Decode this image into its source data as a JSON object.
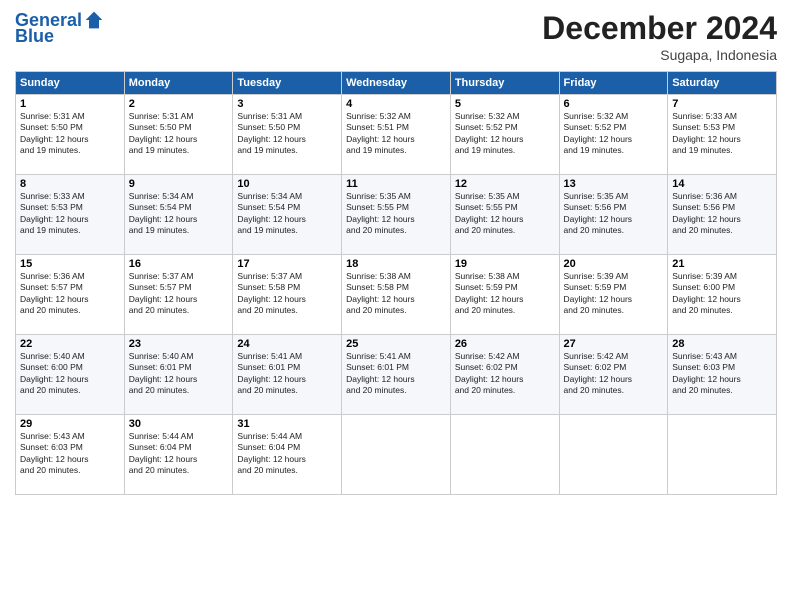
{
  "header": {
    "logo_general": "General",
    "logo_blue": "Blue",
    "month": "December 2024",
    "location": "Sugapa, Indonesia"
  },
  "weekdays": [
    "Sunday",
    "Monday",
    "Tuesday",
    "Wednesday",
    "Thursday",
    "Friday",
    "Saturday"
  ],
  "weeks": [
    [
      {
        "day": "1",
        "sunrise": "5:31 AM",
        "sunset": "5:50 PM",
        "daylight": "12 hours and 19 minutes."
      },
      {
        "day": "2",
        "sunrise": "5:31 AM",
        "sunset": "5:50 PM",
        "daylight": "12 hours and 19 minutes."
      },
      {
        "day": "3",
        "sunrise": "5:31 AM",
        "sunset": "5:50 PM",
        "daylight": "12 hours and 19 minutes."
      },
      {
        "day": "4",
        "sunrise": "5:32 AM",
        "sunset": "5:51 PM",
        "daylight": "12 hours and 19 minutes."
      },
      {
        "day": "5",
        "sunrise": "5:32 AM",
        "sunset": "5:52 PM",
        "daylight": "12 hours and 19 minutes."
      },
      {
        "day": "6",
        "sunrise": "5:32 AM",
        "sunset": "5:52 PM",
        "daylight": "12 hours and 19 minutes."
      },
      {
        "day": "7",
        "sunrise": "5:33 AM",
        "sunset": "5:53 PM",
        "daylight": "12 hours and 19 minutes."
      }
    ],
    [
      {
        "day": "8",
        "sunrise": "5:33 AM",
        "sunset": "5:53 PM",
        "daylight": "12 hours and 19 minutes."
      },
      {
        "day": "9",
        "sunrise": "5:34 AM",
        "sunset": "5:54 PM",
        "daylight": "12 hours and 19 minutes."
      },
      {
        "day": "10",
        "sunrise": "5:34 AM",
        "sunset": "5:54 PM",
        "daylight": "12 hours and 19 minutes."
      },
      {
        "day": "11",
        "sunrise": "5:35 AM",
        "sunset": "5:55 PM",
        "daylight": "12 hours and 20 minutes."
      },
      {
        "day": "12",
        "sunrise": "5:35 AM",
        "sunset": "5:55 PM",
        "daylight": "12 hours and 20 minutes."
      },
      {
        "day": "13",
        "sunrise": "5:35 AM",
        "sunset": "5:56 PM",
        "daylight": "12 hours and 20 minutes."
      },
      {
        "day": "14",
        "sunrise": "5:36 AM",
        "sunset": "5:56 PM",
        "daylight": "12 hours and 20 minutes."
      }
    ],
    [
      {
        "day": "15",
        "sunrise": "5:36 AM",
        "sunset": "5:57 PM",
        "daylight": "12 hours and 20 minutes."
      },
      {
        "day": "16",
        "sunrise": "5:37 AM",
        "sunset": "5:57 PM",
        "daylight": "12 hours and 20 minutes."
      },
      {
        "day": "17",
        "sunrise": "5:37 AM",
        "sunset": "5:58 PM",
        "daylight": "12 hours and 20 minutes."
      },
      {
        "day": "18",
        "sunrise": "5:38 AM",
        "sunset": "5:58 PM",
        "daylight": "12 hours and 20 minutes."
      },
      {
        "day": "19",
        "sunrise": "5:38 AM",
        "sunset": "5:59 PM",
        "daylight": "12 hours and 20 minutes."
      },
      {
        "day": "20",
        "sunrise": "5:39 AM",
        "sunset": "5:59 PM",
        "daylight": "12 hours and 20 minutes."
      },
      {
        "day": "21",
        "sunrise": "5:39 AM",
        "sunset": "6:00 PM",
        "daylight": "12 hours and 20 minutes."
      }
    ],
    [
      {
        "day": "22",
        "sunrise": "5:40 AM",
        "sunset": "6:00 PM",
        "daylight": "12 hours and 20 minutes."
      },
      {
        "day": "23",
        "sunrise": "5:40 AM",
        "sunset": "6:01 PM",
        "daylight": "12 hours and 20 minutes."
      },
      {
        "day": "24",
        "sunrise": "5:41 AM",
        "sunset": "6:01 PM",
        "daylight": "12 hours and 20 minutes."
      },
      {
        "day": "25",
        "sunrise": "5:41 AM",
        "sunset": "6:01 PM",
        "daylight": "12 hours and 20 minutes."
      },
      {
        "day": "26",
        "sunrise": "5:42 AM",
        "sunset": "6:02 PM",
        "daylight": "12 hours and 20 minutes."
      },
      {
        "day": "27",
        "sunrise": "5:42 AM",
        "sunset": "6:02 PM",
        "daylight": "12 hours and 20 minutes."
      },
      {
        "day": "28",
        "sunrise": "5:43 AM",
        "sunset": "6:03 PM",
        "daylight": "12 hours and 20 minutes."
      }
    ],
    [
      {
        "day": "29",
        "sunrise": "5:43 AM",
        "sunset": "6:03 PM",
        "daylight": "12 hours and 20 minutes."
      },
      {
        "day": "30",
        "sunrise": "5:44 AM",
        "sunset": "6:04 PM",
        "daylight": "12 hours and 20 minutes."
      },
      {
        "day": "31",
        "sunrise": "5:44 AM",
        "sunset": "6:04 PM",
        "daylight": "12 hours and 20 minutes."
      },
      null,
      null,
      null,
      null
    ]
  ],
  "labels": {
    "sunrise_prefix": "Sunrise: ",
    "sunset_prefix": "Sunset: ",
    "daylight_prefix": "Daylight: "
  }
}
